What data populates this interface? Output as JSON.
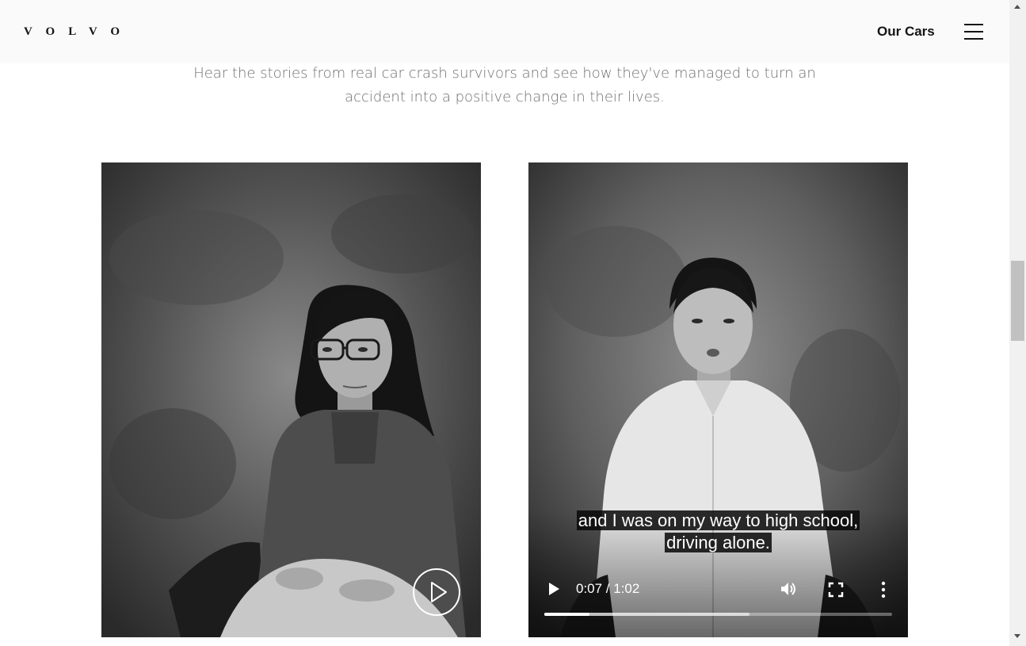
{
  "header": {
    "logo_text": "VOLVO",
    "nav_label": "Our Cars",
    "menu_icon": "hamburger-icon"
  },
  "intro": {
    "line1": "Hear the stories from real car crash survivors and see how they've managed to turn an",
    "line2": "accident into a positive change in their lives."
  },
  "cards": [
    {
      "type": "image",
      "alt": "Portrait of a woman seated in a chair",
      "play_icon": "play-circle-icon"
    },
    {
      "type": "video",
      "caption_line1": "and I was on my way to high school,",
      "caption_line2": "driving alone.",
      "time_display": "0:07 / 1:02",
      "current_time": "0:07",
      "duration": "1:02",
      "progress_fraction": 0.129,
      "buffered_fraction": 0.59,
      "icons": [
        "play-icon",
        "volume-icon",
        "fullscreen-icon",
        "more-options-icon"
      ]
    }
  ],
  "colors": {
    "header_bg": "#fafafa",
    "text_dark": "#141414",
    "intro_text": "#707070",
    "scrollbar_track": "#f1f1f1",
    "scrollbar_thumb": "#c1c1c1"
  }
}
